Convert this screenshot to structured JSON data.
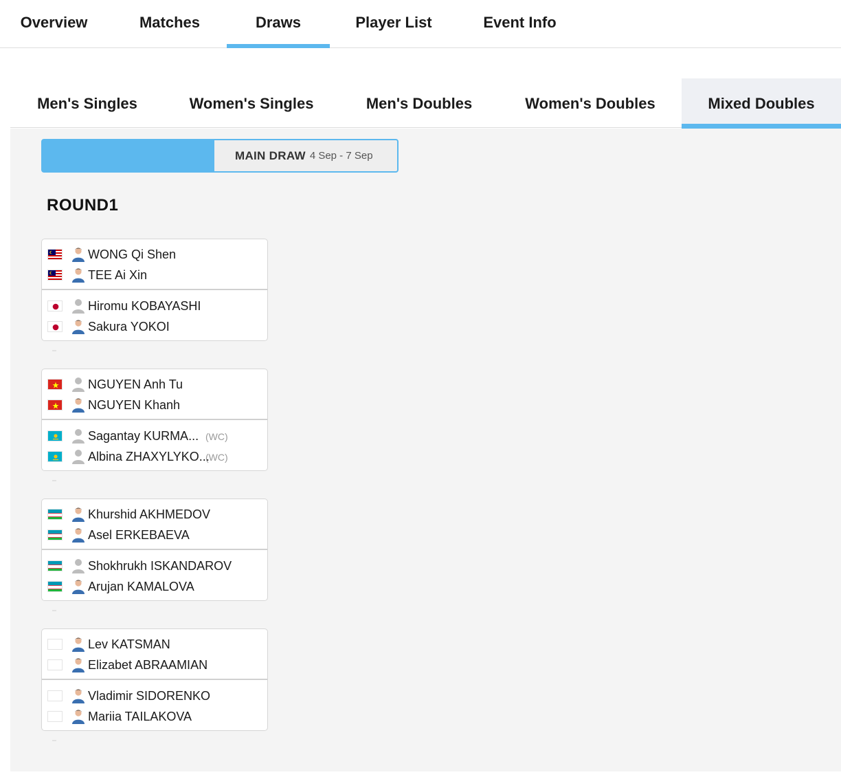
{
  "top_tabs": [
    {
      "label": "Overview",
      "active": false
    },
    {
      "label": "Matches",
      "active": false
    },
    {
      "label": "Draws",
      "active": true
    },
    {
      "label": "Player List",
      "active": false
    },
    {
      "label": "Event Info",
      "active": false
    }
  ],
  "event_tabs": [
    {
      "label": "Men's Singles",
      "active": false
    },
    {
      "label": "Women's Singles",
      "active": false
    },
    {
      "label": "Men's Doubles",
      "active": false
    },
    {
      "label": "Women's Doubles",
      "active": false
    },
    {
      "label": "Mixed Doubles",
      "active": true
    }
  ],
  "draw_selector": {
    "name": "MAIN DRAW",
    "dates": "4 Sep - 7 Sep"
  },
  "round_title": "ROUND1",
  "colors": {
    "accent": "#5cb8ee",
    "content_bg": "#f4f4f4",
    "seed_text": "#9a9a9a"
  },
  "matches": [
    {
      "pairs": [
        {
          "players": [
            {
              "name": "WONG Qi Shen",
              "flag": "malaysia-flag-icon",
              "avatar": "player-photo-icon",
              "seed": ""
            },
            {
              "name": "TEE Ai Xin",
              "flag": "malaysia-flag-icon",
              "avatar": "player-photo-icon",
              "seed": ""
            }
          ]
        },
        {
          "players": [
            {
              "name": "Hiromu KOBAYASHI",
              "flag": "japan-flag-icon",
              "avatar": "placeholder-avatar-icon",
              "seed": ""
            },
            {
              "name": "Sakura YOKOI",
              "flag": "japan-flag-icon",
              "avatar": "player-photo-icon",
              "seed": ""
            }
          ]
        }
      ]
    },
    {
      "pairs": [
        {
          "players": [
            {
              "name": "NGUYEN Anh Tu",
              "flag": "vietnam-flag-icon",
              "avatar": "placeholder-avatar-icon",
              "seed": ""
            },
            {
              "name": "NGUYEN Khanh",
              "flag": "vietnam-flag-icon",
              "avatar": "player-photo-icon",
              "seed": ""
            }
          ]
        },
        {
          "players": [
            {
              "name": "Sagantay KURMA...",
              "flag": "kazakhstan-flag-icon",
              "avatar": "placeholder-avatar-icon",
              "seed": "(WC)"
            },
            {
              "name": "Albina ZHAXYLYKO...",
              "flag": "kazakhstan-flag-icon",
              "avatar": "placeholder-avatar-icon",
              "seed": "(WC)"
            }
          ]
        }
      ]
    },
    {
      "pairs": [
        {
          "players": [
            {
              "name": "Khurshid AKHMEDOV",
              "flag": "uzbekistan-flag-icon",
              "avatar": "player-photo-icon",
              "seed": ""
            },
            {
              "name": "Asel ERKEBAEVA",
              "flag": "uzbekistan-flag-icon",
              "avatar": "player-photo-icon",
              "seed": ""
            }
          ]
        },
        {
          "players": [
            {
              "name": "Shokhrukh ISKANDAROV",
              "flag": "uzbekistan-flag-icon",
              "avatar": "placeholder-avatar-icon",
              "seed": ""
            },
            {
              "name": "Arujan KAMALOVA",
              "flag": "uzbekistan-flag-icon",
              "avatar": "player-photo-icon",
              "seed": ""
            }
          ]
        }
      ]
    },
    {
      "pairs": [
        {
          "players": [
            {
              "name": "Lev KATSMAN",
              "flag": "blank-flag-icon",
              "avatar": "player-photo-icon",
              "seed": ""
            },
            {
              "name": "Elizabet ABRAAMIAN",
              "flag": "blank-flag-icon",
              "avatar": "player-photo-icon",
              "seed": ""
            }
          ]
        },
        {
          "players": [
            {
              "name": "Vladimir SIDORENKO",
              "flag": "blank-flag-icon",
              "avatar": "player-photo-icon",
              "seed": ""
            },
            {
              "name": "Mariia TAILAKOVA",
              "flag": "blank-flag-icon",
              "avatar": "player-photo-icon",
              "seed": ""
            }
          ]
        }
      ]
    }
  ]
}
